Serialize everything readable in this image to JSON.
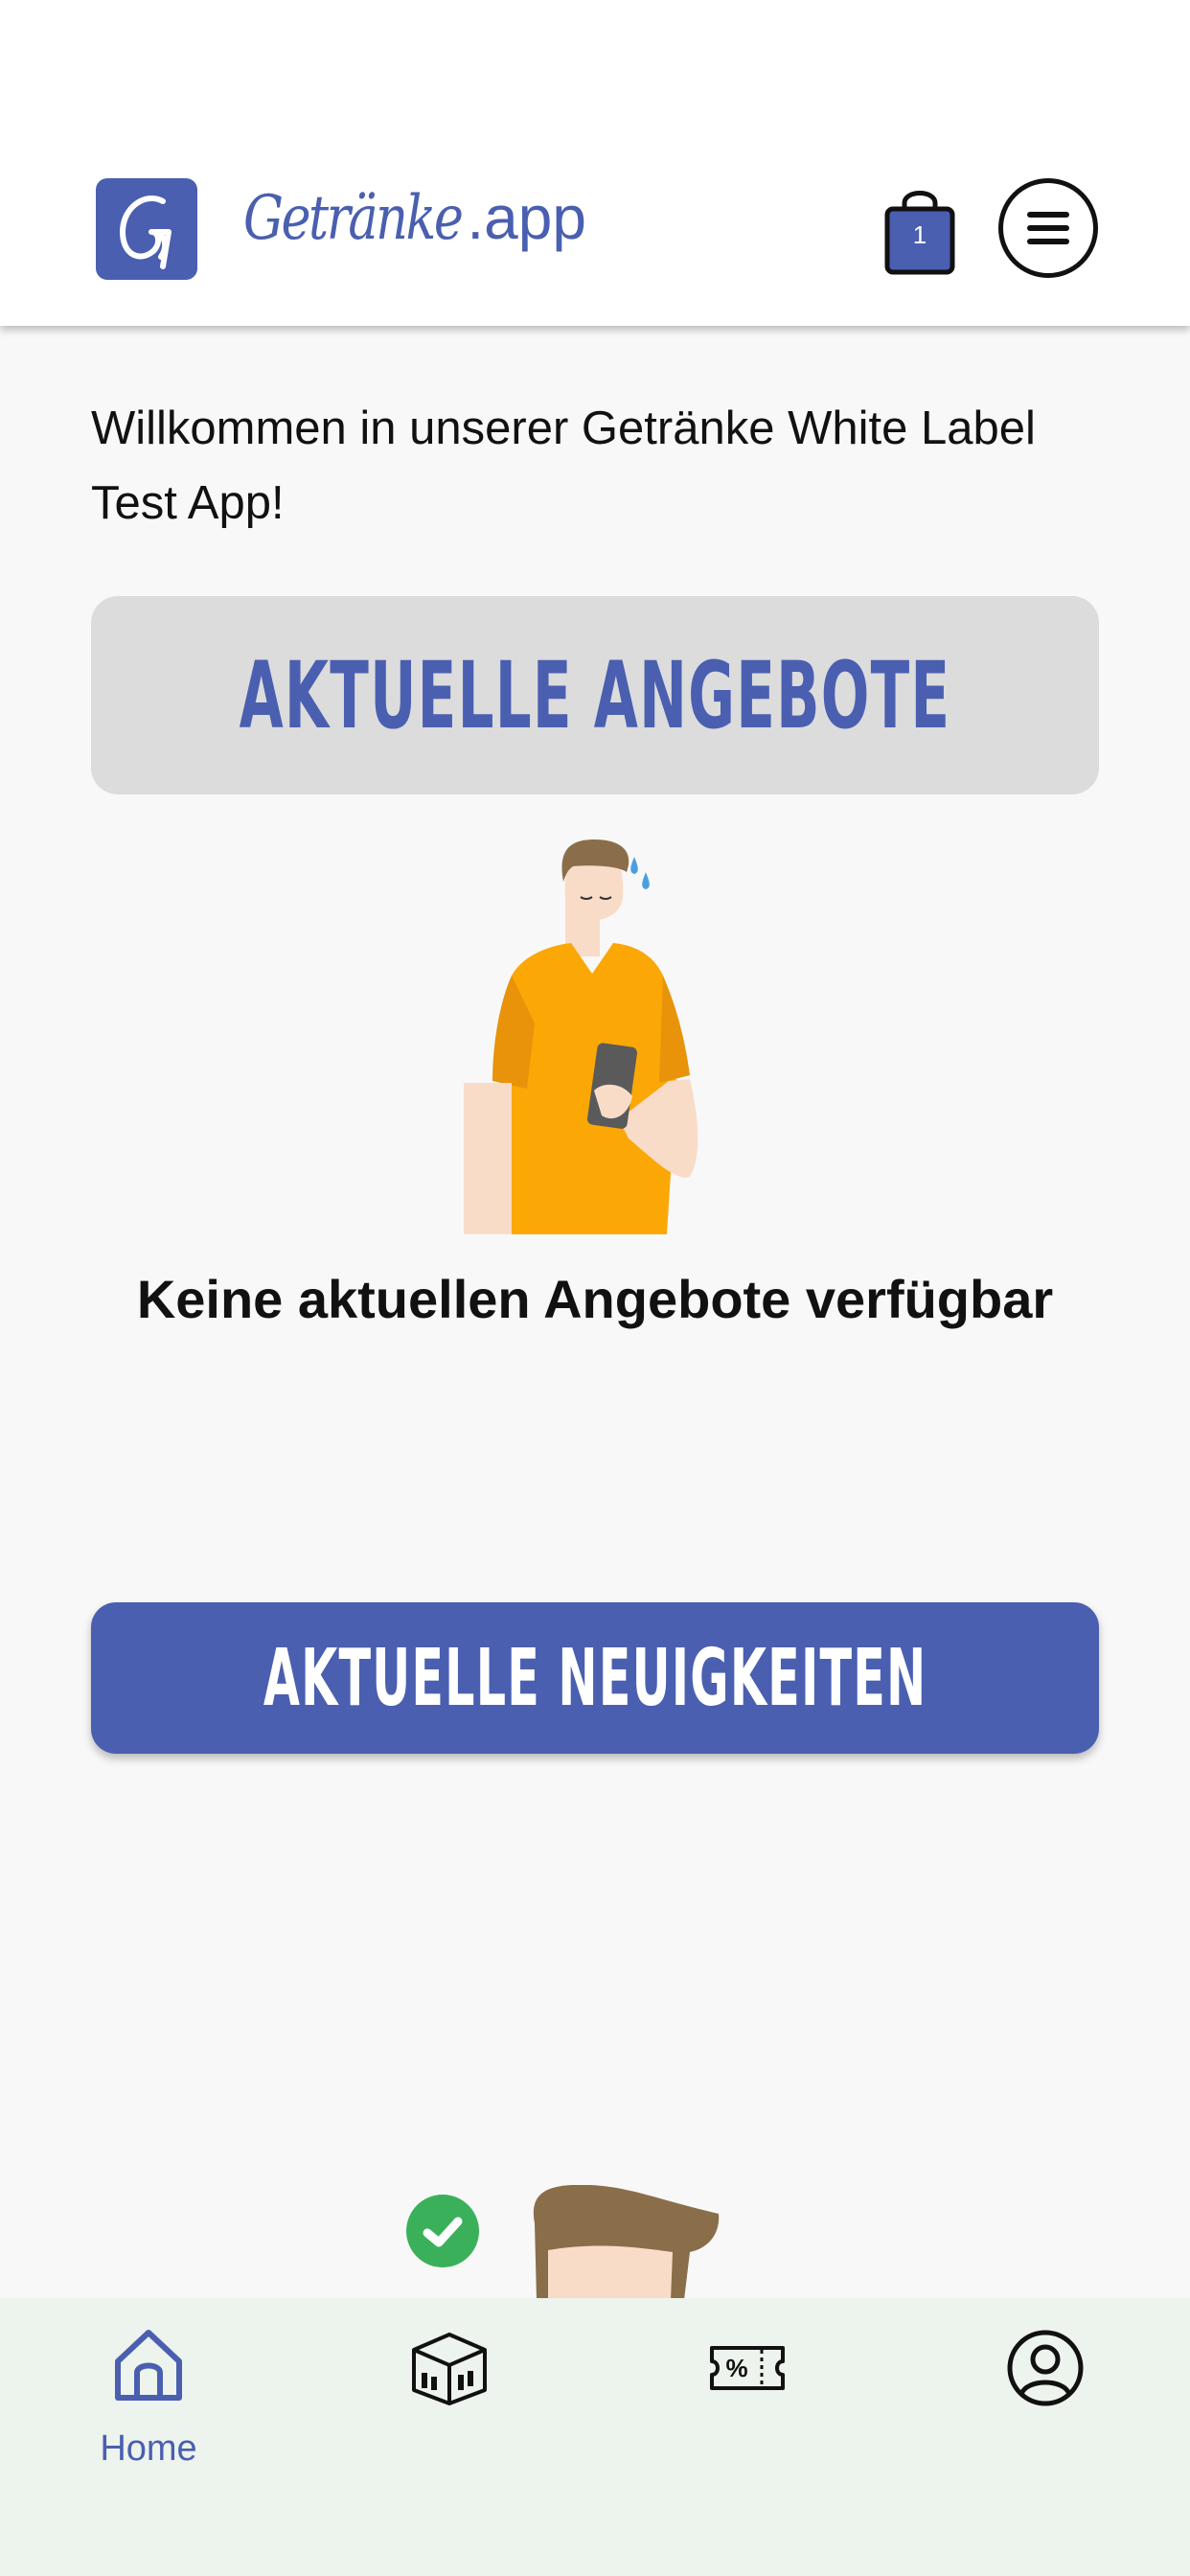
{
  "header": {
    "logo_letter": "G",
    "brand_script": "Getränke",
    "brand_suffix": ".app",
    "cart_count": "1",
    "accent_color": "#4a5fb0"
  },
  "main": {
    "welcome_text": "Willkommen in unserer Getränke White Label Test App!",
    "offers_banner": "Aktuelle Angebote",
    "empty_offers_text": "Keine aktuellen Angebote verfügbar",
    "news_button": "Aktuelle Neuigkeiten"
  },
  "bottom_nav": {
    "items": [
      {
        "label": "Home",
        "icon": "home-icon",
        "active": true
      },
      {
        "label": "",
        "icon": "products-box-icon",
        "active": false
      },
      {
        "label": "",
        "icon": "coupon-icon",
        "active": false
      },
      {
        "label": "",
        "icon": "profile-icon",
        "active": false
      }
    ]
  }
}
